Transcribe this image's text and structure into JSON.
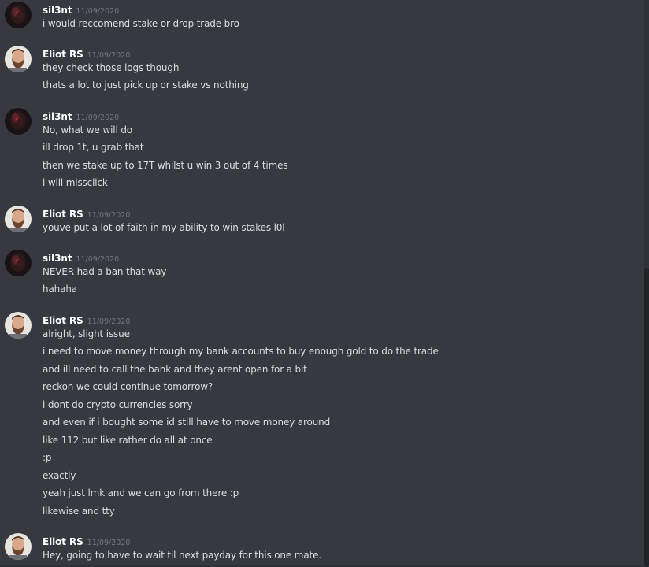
{
  "colors": {
    "background": "#36393f",
    "username": "#ffffff",
    "timestamp": "#72767d",
    "message_text": "#dcddde"
  },
  "messages": [
    {
      "author": "sil3nt",
      "avatar_icon": "dark-character-avatar-icon",
      "timestamp": "11/09/2020",
      "lines": [
        "i would reccomend stake or drop trade bro"
      ]
    },
    {
      "author": "Eliot RS",
      "avatar_icon": "bearded-man-avatar-icon",
      "timestamp": "11/09/2020",
      "lines": [
        "they check those logs though",
        "thats a lot to just pick up or stake vs nothing"
      ]
    },
    {
      "author": "sil3nt",
      "avatar_icon": "dark-character-avatar-icon",
      "timestamp": "11/09/2020",
      "lines": [
        "No, what we will do",
        "ill drop 1t, u grab that",
        "then we stake up to 17T whilst u win 3 out of 4 times",
        "i will missclick"
      ]
    },
    {
      "author": "Eliot RS",
      "avatar_icon": "bearded-man-avatar-icon",
      "timestamp": "11/09/2020",
      "lines": [
        "youve put a lot of faith in my ability to win stakes l0l"
      ]
    },
    {
      "author": "sil3nt",
      "avatar_icon": "dark-character-avatar-icon",
      "timestamp": "11/09/2020",
      "lines": [
        "NEVER had a ban that way",
        "hahaha"
      ]
    },
    {
      "author": "Eliot RS",
      "avatar_icon": "bearded-man-avatar-icon",
      "timestamp": "11/09/2020",
      "lines": [
        "alright, slight issue",
        "i need to move money through my bank accounts to buy enough gold to do the trade",
        "and ill need to call the bank and they arent open for a bit",
        "reckon we could continue tomorrow?",
        "i dont do crypto currencies sorry",
        "and even if i bought some id still have to move money around",
        "like 112 but like rather do all at once",
        ":p",
        "exactly",
        "yeah just lmk and we can go from there :p",
        "likewise and tty"
      ]
    },
    {
      "author": "Eliot RS",
      "avatar_icon": "bearded-man-avatar-icon",
      "timestamp": "11/09/2020",
      "lines": [
        "Hey, going to have to wait til next payday for this one mate."
      ]
    }
  ]
}
